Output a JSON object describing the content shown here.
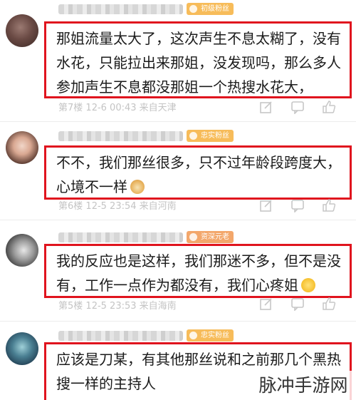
{
  "comments": [
    {
      "badge": "初级粉丝",
      "text": "那姐流量太大了，这次声生不息太糊了，没有水花，只能拉出来那姐，没发现吗，那么多人参加声生不息都没那姐一个热搜水花大，",
      "floor": "第7楼",
      "datetime": "12-6 00:43",
      "location": "来自天津"
    },
    {
      "badge": "忠实粉丝",
      "text": "不不，我们那丝很多，只不过年龄段跨度大，心境不一样",
      "emoji": "dog-emoji",
      "floor": "第6楼",
      "datetime": "12-5 23:54",
      "location": "来自河南"
    },
    {
      "badge": "资深元老",
      "text": "我的反应也是这样，我们那迷不多，但不是没有，工作一点作为都没有，我们心疼姐",
      "emoji": "crying-emoji",
      "floor": "第5楼",
      "datetime": "12-5 23:53",
      "location": "来自海南"
    },
    {
      "badge": "忠实粉丝",
      "text": "应该是刀某，有其他那丝说和之前那几个黑热搜一样的主持人"
    }
  ],
  "colors": {
    "highlight_border": "#e0141e",
    "badge_basic": "#f5a623",
    "badge_loyal": "#f5a623",
    "badge_senior": "#f08a3a"
  },
  "icons": [
    "edit-icon",
    "comment-icon",
    "like-icon"
  ],
  "watermark": "脉冲手游网"
}
